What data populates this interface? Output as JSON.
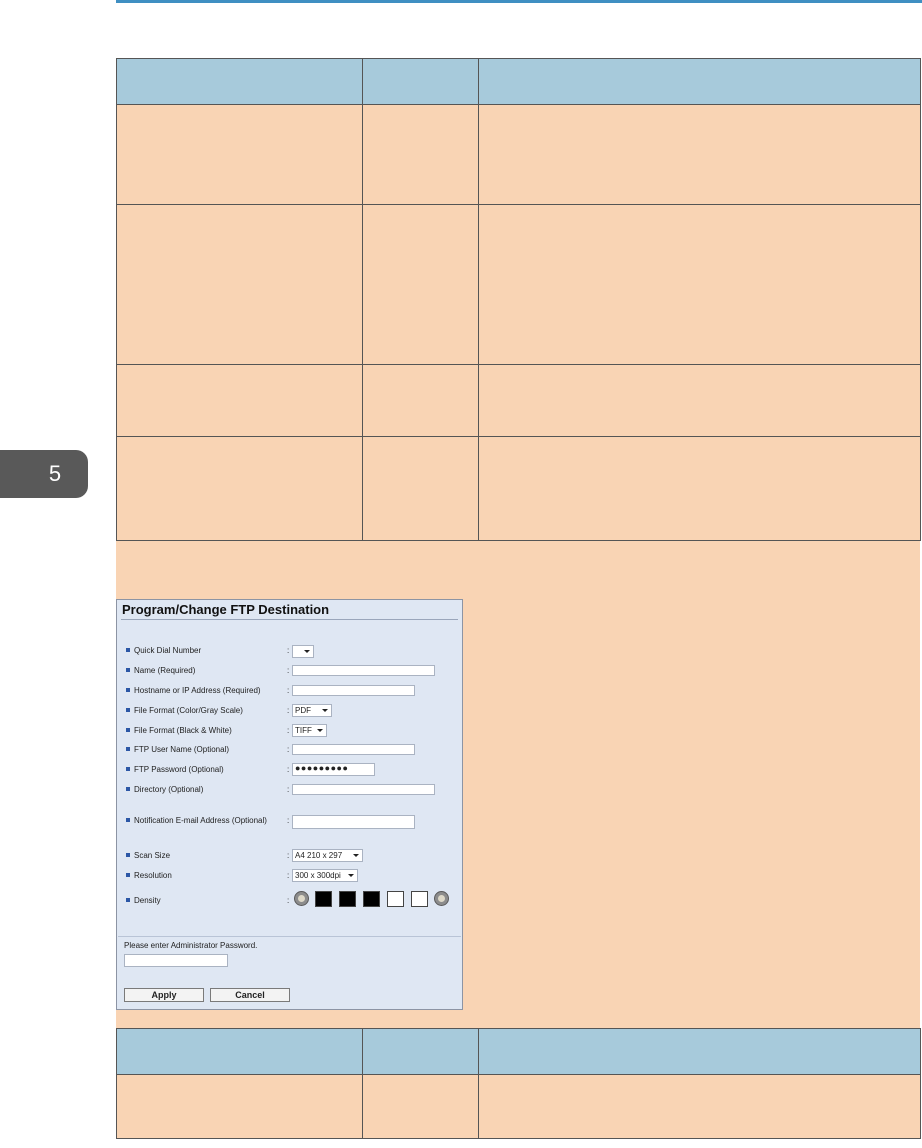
{
  "page": {
    "chapter_number": "5"
  },
  "table_1": {
    "header": [
      "",
      "",
      ""
    ],
    "rows": [
      [
        "",
        "",
        ""
      ],
      [
        "",
        "",
        ""
      ],
      [
        "",
        "",
        ""
      ],
      [
        "",
        "",
        ""
      ]
    ]
  },
  "ftp_dialog": {
    "title": "Program/Change FTP Destination",
    "fields": {
      "quick_dial_label": "Quick Dial Number",
      "quick_dial_value": "",
      "name_label": "Name (Required)",
      "name_value": "",
      "hostname_label": "Hostname or IP Address (Required)",
      "hostname_value": "",
      "format_color_label": "File Format (Color/Gray Scale)",
      "format_color_value": "PDF",
      "format_bw_label": "File Format (Black & White)",
      "format_bw_value": "TIFF",
      "ftp_user_label": "FTP User Name (Optional)",
      "ftp_user_value": "",
      "ftp_password_label": "FTP Password (Optional)",
      "ftp_password_value": "●●●●●●●●●",
      "directory_label": "Directory (Optional)",
      "directory_value": "",
      "notification_label": "Notification E-mail Address (Optional)",
      "notification_value": "",
      "scan_size_label": "Scan Size",
      "scan_size_value": "A4 210 x 297",
      "resolution_label": "Resolution",
      "resolution_value": "300 x 300dpi",
      "density_label": "Density"
    },
    "colon": ":",
    "density_level": 3,
    "density_steps": 5,
    "admin_prompt": "Please enter Administrator Password.",
    "admin_password_value": "",
    "apply_label": "Apply",
    "cancel_label": "Cancel"
  },
  "table_2": {
    "header": [
      "",
      "",
      ""
    ],
    "rows": [
      [
        "",
        "",
        ""
      ]
    ]
  },
  "colors": {
    "accent_rule": "#3f8fc2",
    "table_header": "#a7cadb",
    "table_body": "#f9d4b4",
    "chapter_tab": "#595959",
    "dialog_background": "#dfe7f3"
  }
}
